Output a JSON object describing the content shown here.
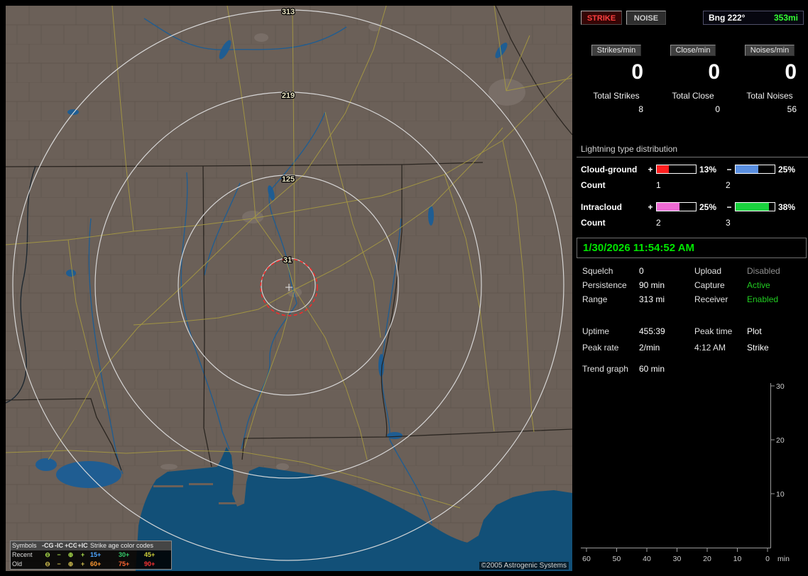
{
  "map": {
    "range_labels": [
      "313",
      "219",
      "125",
      "31"
    ],
    "legend": {
      "col_header": "Symbols",
      "type_headers": [
        "-CG",
        "-IC",
        "+CG",
        "+IC"
      ],
      "age_header": "Strike age color codes",
      "rows": [
        {
          "label": "Recent",
          "symbols": [
            "⊖",
            "−",
            "⊕",
            "+"
          ],
          "symbol_color": "#aade4b",
          "ages": [
            {
              "text": "15+",
              "color": "#4da6ff"
            },
            {
              "text": "30+",
              "color": "#35cc6a"
            },
            {
              "text": "45+",
              "color": "#cfcf3a"
            }
          ]
        },
        {
          "label": "Old",
          "symbols": [
            "⊖",
            "−",
            "⊕",
            "+"
          ],
          "symbol_color": "#cdbb4e",
          "ages": [
            {
              "text": "60+",
              "color": "#ff9a33"
            },
            {
              "text": "75+",
              "color": "#ff6633"
            },
            {
              "text": "90+",
              "color": "#ff3333"
            }
          ]
        }
      ]
    },
    "credit": "©2005 Astrogenic Systems"
  },
  "panel": {
    "strike_button": "STRIKE",
    "noise_button": "NOISE",
    "bearing": {
      "label": "Bng 222°",
      "distance": "353mi",
      "distance_color": "#33ff33"
    },
    "counters": [
      {
        "label": "Strikes/min",
        "value": "0",
        "total_label": "Total Strikes",
        "total": "8"
      },
      {
        "label": "Close/min",
        "value": "0",
        "total_label": "Total Close",
        "total": "0"
      },
      {
        "label": "Noises/min",
        "value": "0",
        "total_label": "Total Noises",
        "total": "56"
      }
    ],
    "distribution": {
      "title": "Lightning type distribution",
      "count_label": "Count",
      "rows": [
        {
          "label": "Cloud-ground",
          "plus_sign": "+",
          "minus_sign": "−",
          "plus_pct": "13%",
          "minus_pct": "25%",
          "plus_count": "1",
          "minus_count": "2",
          "plus_color": "#ff1f1f",
          "minus_color": "#5a8fe0",
          "plus_fill": 30,
          "minus_fill": 58
        },
        {
          "label": "Intracloud",
          "plus_sign": "+",
          "minus_sign": "−",
          "plus_pct": "25%",
          "minus_pct": "38%",
          "plus_count": "2",
          "minus_count": "3",
          "plus_color": "#ef6ad4",
          "minus_color": "#1ad23e",
          "plus_fill": 58,
          "minus_fill": 86
        }
      ]
    },
    "clock": "1/30/2026 11:54:52 AM",
    "settings": [
      {
        "label": "Squelch",
        "value": "0",
        "label2": "Upload",
        "value2": "Disabled",
        "value2_color": "#8f8f8f"
      },
      {
        "label": "Persistence",
        "value": "90 min",
        "label2": "Capture",
        "value2": "Active",
        "value2_color": "#21cc21"
      },
      {
        "label": "Range",
        "value": "313 mi",
        "label2": "Receiver",
        "value2": "Enabled",
        "value2_color": "#21cc21"
      }
    ],
    "stats": {
      "uptime_label": "Uptime",
      "uptime": "455:39",
      "peak_time_label": "Peak time",
      "plot_label": "Plot",
      "peak_rate_label": "Peak rate",
      "peak_rate": "2/min",
      "peak_time": "4:12 AM",
      "plot_mode": "Strike",
      "trend_label": "Trend graph",
      "trend_window": "60 min"
    }
  },
  "chart_data": {
    "type": "line",
    "title": "Strike rate trend graph (last 60 min)",
    "x_ticks": [
      "60",
      "50",
      "40",
      "30",
      "20",
      "10",
      "0"
    ],
    "x_unit": "min",
    "y_ticks": [
      "30",
      "20",
      "10"
    ],
    "xlim": [
      60,
      0
    ],
    "ylim": [
      0,
      30
    ],
    "legend_position": "none",
    "grid": false,
    "series": [
      {
        "name": "Strike",
        "values": []
      }
    ]
  }
}
